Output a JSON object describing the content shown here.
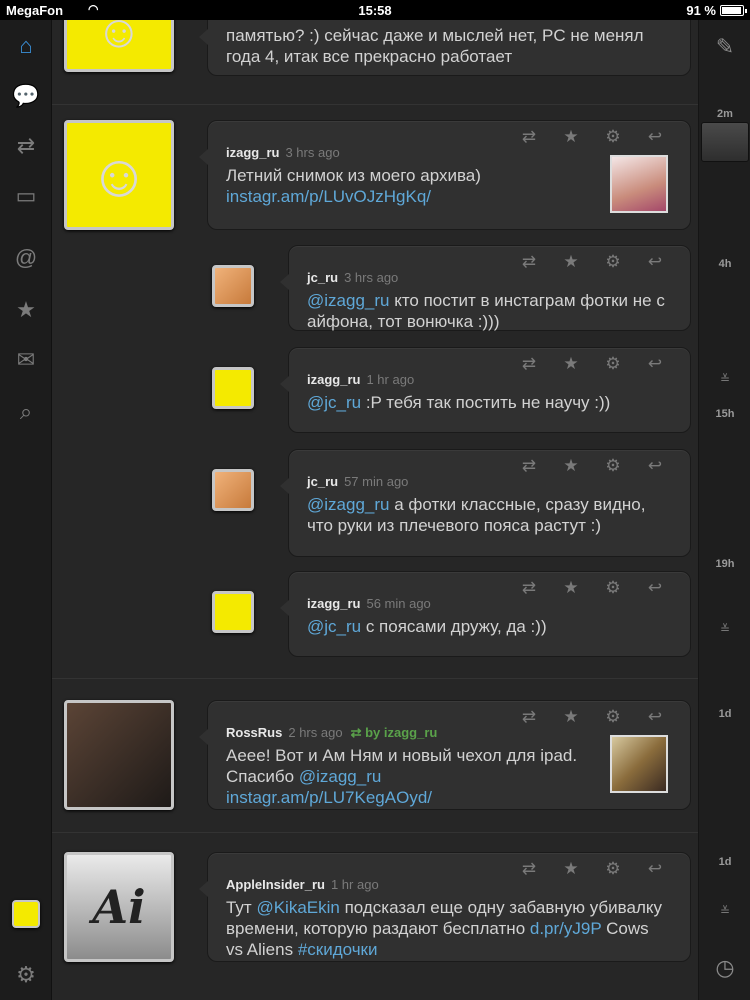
{
  "status_bar": {
    "carrier": "MegaFon",
    "time": "15:58",
    "battery": "91 %"
  },
  "sidebar": {
    "items": [
      {
        "name": "home-icon",
        "glyph": "⌂"
      },
      {
        "name": "messages-icon",
        "glyph": "💬"
      },
      {
        "name": "retweets-icon",
        "glyph": "⇄"
      },
      {
        "name": "photos-icon",
        "glyph": "▭"
      },
      {
        "name": "mentions-icon",
        "glyph": "@"
      },
      {
        "name": "favorites-icon",
        "glyph": "★"
      },
      {
        "name": "mail-icon",
        "glyph": "✉"
      },
      {
        "name": "search-icon",
        "glyph": "⌕"
      }
    ]
  },
  "action_icons": {
    "retweet": "⇄",
    "favorite": "★",
    "settings": "⚙",
    "reply": "↩"
  },
  "tweets": [
    {
      "text": "памятью? :) сейчас даже и мыслей нет, PC не менял года 4, итак все прекрасно работает"
    },
    {
      "user": "izagg_ru",
      "time": "3 hrs ago",
      "text": "Летний снимок из моего архива)",
      "link": "instagr.am/p/LUvOJzHgKq/"
    },
    {
      "user": "jc_ru",
      "time": "3 hrs ago",
      "mention": "@izagg_ru",
      "text": " кто постит в инстаграм фотки не с айфона, тот вонючка :)))"
    },
    {
      "user": "izagg_ru",
      "time": "1 hr ago",
      "mention": "@jc_ru",
      "text": " :P тебя так постить не научу :))"
    },
    {
      "user": "jc_ru",
      "time": "57 min ago",
      "mention": "@izagg_ru",
      "text": " а фотки классные, сразу видно, что руки из плечевого пояса растут :)"
    },
    {
      "user": "izagg_ru",
      "time": "56 min ago",
      "mention": "@jc_ru",
      "text": " с поясами дружу, да :))"
    },
    {
      "user": "RossRus",
      "time": "2 hrs ago",
      "rt": "by izagg_ru",
      "text_a": "Аеее! Вот и Ам Ням и новый чехол для ipad. Спасибо ",
      "mention": "@izagg_ru",
      "link": "instagr.am/p/LU7KegAOyd/"
    },
    {
      "user": "AppleInsider_ru",
      "time": "1 hr ago",
      "text_a": "Тут ",
      "mention": "@KikaEkin",
      "text_b": " подсказал еще одну забавную убивалку времени, которую раздают бесплатно ",
      "link": "d.pr/yJ9P",
      "text_c": " Cows vs Aliens ",
      "hashtag": "#скидочки"
    }
  ],
  "rail": {
    "ticks": [
      "2m",
      "4h",
      "15h",
      "19h",
      "1d",
      "1d"
    ]
  },
  "colors": {
    "accent": "#3a8fd8",
    "link": "#5fa8d8",
    "retweet": "#5aa24a"
  }
}
